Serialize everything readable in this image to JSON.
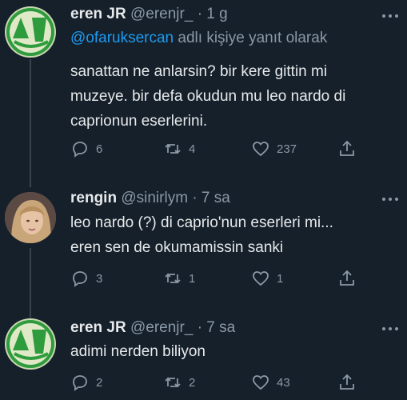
{
  "tweets": [
    {
      "name": "eren JR",
      "handle": "@erenjr_",
      "time": "· 1 g",
      "reply_prefix": "@ofaruksercan",
      "reply_suffix": " adlı kişiye yanıt olarak",
      "lines": [
        "sanattan ne anlarsin? bir kere gittin mi",
        "muzeye. bir defa okudun mu leo nardo di",
        "caprionun eserlerini."
      ],
      "replies": "6",
      "retweets": "4",
      "likes": "237"
    },
    {
      "name": "rengin",
      "handle": "@sinirlym",
      "time": "· 7 sa",
      "lines": [
        "leo nardo (?) di caprio'nun eserleri mi...",
        "eren sen de okumamissin sanki"
      ],
      "replies": "3",
      "retweets": "1",
      "likes": "1"
    },
    {
      "name": "eren JR",
      "handle": "@erenjr_",
      "time": "· 7 sa",
      "lines": [
        "adimi nerden biliyon"
      ],
      "replies": "2",
      "retweets": "2",
      "likes": "43"
    }
  ],
  "icons": {
    "reply": "reply-icon",
    "retweet": "retweet-icon",
    "like": "heart-icon",
    "share": "share-icon",
    "more": "more-icon"
  },
  "colors": {
    "background": "#15202b",
    "text": "#e7e9ea",
    "muted": "#8b98a5",
    "link": "#1d9bf0"
  }
}
